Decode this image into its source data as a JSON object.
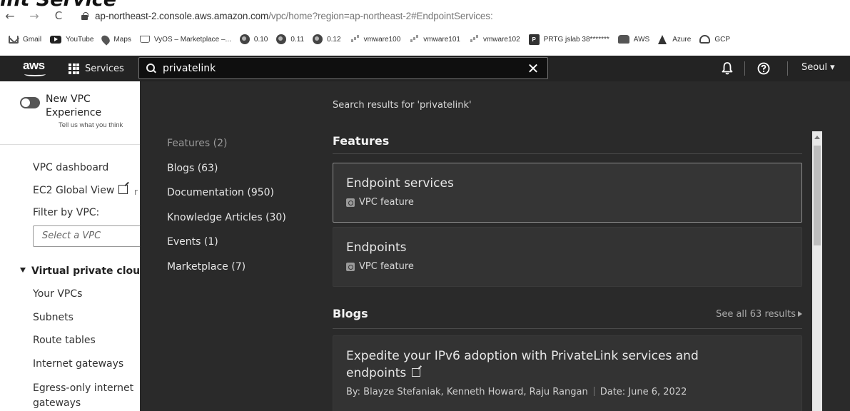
{
  "page_heading_fragment": "int Service",
  "browser": {
    "url_main": "ap-northeast-2.console.aws.amazon.com",
    "url_path": "/vpc/home?region=ap-northeast-2#EndpointServices:",
    "back_glyph": "←",
    "forward_glyph": "→",
    "reload_glyph": "C"
  },
  "bookmarks": [
    {
      "label": "Gmail",
      "icon": "gmail-icon"
    },
    {
      "label": "YouTube",
      "icon": "youtube-icon"
    },
    {
      "label": "Maps",
      "icon": "maps-icon"
    },
    {
      "label": "VyOS – Marketplace –...",
      "icon": "cart-icon"
    },
    {
      "label": "0.10",
      "icon": "globe-icon"
    },
    {
      "label": "0.11",
      "icon": "globe-icon"
    },
    {
      "label": "0.12",
      "icon": "globe-icon"
    },
    {
      "label": "vmware100",
      "icon": "vmware-icon"
    },
    {
      "label": "vmware101",
      "icon": "vmware-icon"
    },
    {
      "label": "vmware102",
      "icon": "vmware-icon"
    },
    {
      "label": "PRTG jslab 38*******",
      "icon": "prtg-icon"
    },
    {
      "label": "AWS",
      "icon": "aws-icon"
    },
    {
      "label": "Azure",
      "icon": "azure-icon"
    },
    {
      "label": "GCP",
      "icon": "gcp-icon"
    }
  ],
  "topnav": {
    "logo": "aws",
    "services_label": "Services",
    "search_value": "privatelink",
    "clear_glyph": "✕",
    "region_label": "Seoul ▾"
  },
  "sidebar": {
    "new_vpc_title": "New VPC Experience",
    "new_vpc_sub": "Tell us what you think",
    "vpc_dashboard": "VPC dashboard",
    "ec2_global_view": "EC2 Global View",
    "filter_label": "Filter by VPC:",
    "select_placeholder": "Select a VPC",
    "section_title": "Virtual private cloud",
    "items": [
      "Your VPCs",
      "Subnets",
      "Route tables",
      "Internet gateways",
      "Egress-only internet gateways"
    ]
  },
  "search": {
    "results_heading": "Search results for 'privatelink'",
    "facets": [
      {
        "label": "Features (2)",
        "active": false
      },
      {
        "label": "Blogs (63)",
        "active": true
      },
      {
        "label": "Documentation (950)",
        "active": true
      },
      {
        "label": "Knowledge Articles (30)",
        "active": true
      },
      {
        "label": "Events (1)",
        "active": true
      },
      {
        "label": "Marketplace (7)",
        "active": true
      }
    ],
    "features_title": "Features",
    "features": [
      {
        "title": "Endpoint services",
        "meta": "VPC feature",
        "selected": true
      },
      {
        "title": "Endpoints",
        "meta": "VPC feature",
        "selected": false
      }
    ],
    "blogs_title": "Blogs",
    "blogs_see_all": "See all 63 results",
    "blog": {
      "title": "Expedite your IPv6 adoption with PrivateLink services and endpoints",
      "authors": "By: Blayze Stefaniak, Kenneth Howard, Raju Rangan",
      "date": "Date: June 6, 2022"
    }
  }
}
